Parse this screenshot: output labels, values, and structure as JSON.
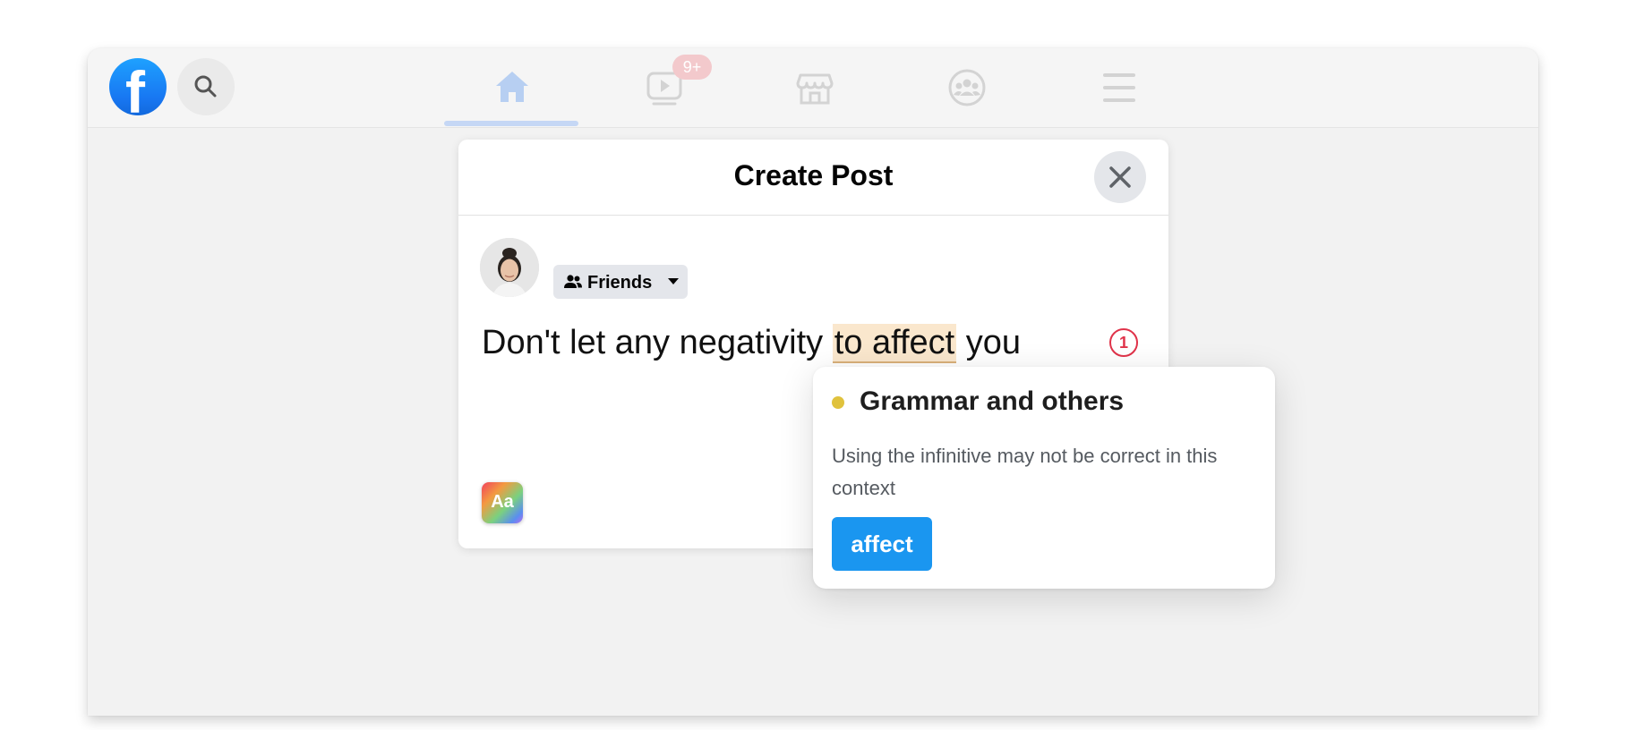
{
  "topbar": {
    "icons": [
      "facebook-logo",
      "search-icon",
      "home-icon",
      "watch-icon",
      "marketplace-icon",
      "groups-icon",
      "menu-icon"
    ],
    "watch_badge": "9+",
    "logo_letter": "f",
    "accent": "#1877f2"
  },
  "dialog": {
    "title": "Create Post",
    "audience_label": "Friends",
    "post_text_before": "Don't let any negativity ",
    "post_text_highlight": "to affect",
    "post_text_after": " you",
    "issue_count": "1",
    "text_format_label": "Aa"
  },
  "grammar_popover": {
    "category": "Grammar and others",
    "description": "Using the infinitive may not be correct in this context",
    "suggestion": "affect",
    "category_color": "#e0c23d",
    "suggestion_color": "#1a96f0"
  }
}
